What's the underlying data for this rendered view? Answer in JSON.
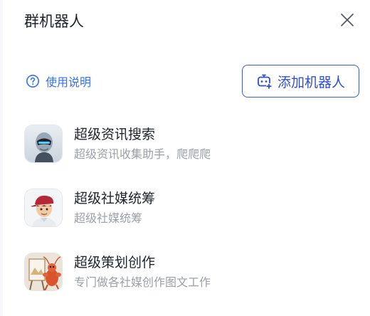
{
  "header": {
    "title": "群机器人",
    "close_icon": "close-icon"
  },
  "toolbar": {
    "help_label": "使用说明",
    "help_icon": "question-circle-icon",
    "add_label": "添加机器人",
    "add_icon": "bot-plus-icon"
  },
  "colors": {
    "accent": "#3370ff",
    "button_border": "#3a5bd6",
    "muted": "#9aa0a6"
  },
  "bots": [
    {
      "name": "超级资讯搜索",
      "desc": "超级资讯收集助手，爬爬爬",
      "avatar": "robot-avatar"
    },
    {
      "name": "超级社媒统筹",
      "desc": "超级社媒统筹",
      "avatar": "cartoon-boy-avatar"
    },
    {
      "name": "超级策划创作",
      "desc": "专门做各社媒创作图文工作",
      "avatar": "lobster-painter-avatar"
    }
  ]
}
